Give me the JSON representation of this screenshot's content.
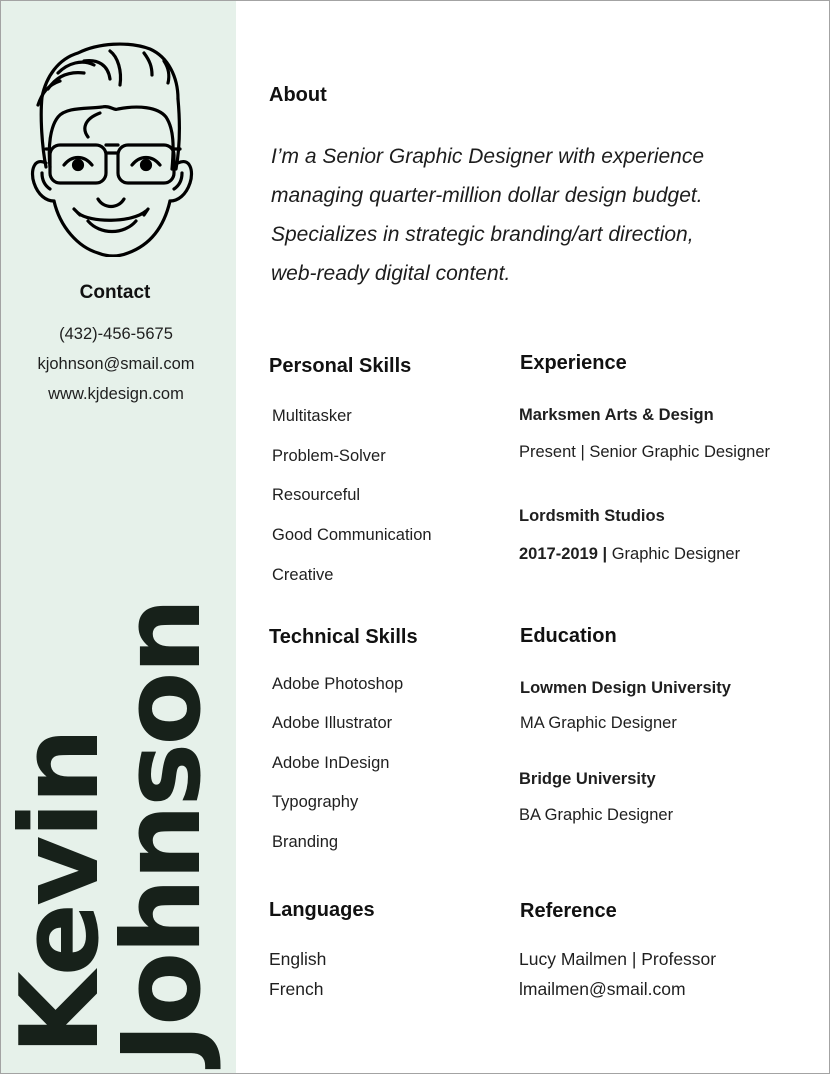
{
  "sidebar": {
    "avatar_icon": "cartoon-face-with-glasses",
    "contact": {
      "title": "Contact",
      "phone": "(432)-456-5675",
      "email": "kjohnson@smail.com",
      "website": "www.kjdesign.com"
    },
    "name": {
      "first": "Kevin",
      "last": "Johnson"
    }
  },
  "colors": {
    "sidebar_bg": "#e6f1ea",
    "name_text": "#17211a",
    "page_bg": "#ffffff"
  },
  "about": {
    "title": "About",
    "lines": [
      "I’m a Senior Graphic Designer with experience",
      "managing quarter-million dollar design budget.",
      "Specializes in strategic branding/art direction,",
      "web-ready digital content."
    ]
  },
  "personal_skills": {
    "title": "Personal Skills",
    "items": [
      "Multitasker",
      "Problem-Solver",
      "Resourceful",
      "Good Communication",
      "Creative"
    ]
  },
  "technical_skills": {
    "title": "Technical Skills",
    "items": [
      "Adobe Photoshop",
      "Adobe Illustrator",
      "Adobe InDesign",
      "Typography",
      "Branding"
    ]
  },
  "languages": {
    "title": "Languages",
    "items": [
      "English",
      "French"
    ]
  },
  "experience": {
    "title": "Experience",
    "entries": [
      {
        "company": "Marksmen Arts & Design",
        "period": "Present |",
        "role": "Senior Graphic Designer"
      },
      {
        "company": "Lordsmith Studios",
        "period": "2017-2019 |",
        "role": "Graphic Designer"
      }
    ]
  },
  "education": {
    "title": "Education",
    "entries": [
      {
        "school": "Lowmen Design University",
        "degree": "MA Graphic Designer"
      },
      {
        "school": "Bridge University",
        "degree": "BA Graphic Designer"
      }
    ]
  },
  "reference": {
    "title": "Reference",
    "name_line": "Lucy Mailmen | Professor",
    "email": "lmailmen@smail.com"
  }
}
